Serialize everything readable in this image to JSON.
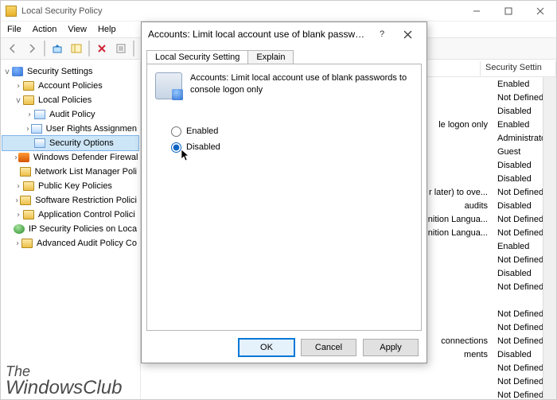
{
  "window": {
    "title": "Local Security Policy",
    "menus": [
      "File",
      "Action",
      "View",
      "Help"
    ]
  },
  "tree": {
    "root": "Security Settings",
    "items": [
      {
        "label": "Account Policies",
        "icon": "folder",
        "depth": 1,
        "twisty": ">"
      },
      {
        "label": "Local Policies",
        "icon": "folder",
        "depth": 1,
        "twisty": "v"
      },
      {
        "label": "Audit Policy",
        "icon": "book",
        "depth": 2,
        "twisty": ">"
      },
      {
        "label": "User Rights Assignmen",
        "icon": "book",
        "depth": 2,
        "twisty": ">"
      },
      {
        "label": "Security Options",
        "icon": "book",
        "depth": 2,
        "twisty": "",
        "selected": true
      },
      {
        "label": "Windows Defender Firewal",
        "icon": "fire",
        "depth": 1,
        "twisty": ">"
      },
      {
        "label": "Network List Manager Poli",
        "icon": "folder",
        "depth": 1,
        "twisty": ""
      },
      {
        "label": "Public Key Policies",
        "icon": "folder",
        "depth": 1,
        "twisty": ">"
      },
      {
        "label": "Software Restriction Polici",
        "icon": "folder",
        "depth": 1,
        "twisty": ">"
      },
      {
        "label": "Application Control Polici",
        "icon": "folder",
        "depth": 1,
        "twisty": ">"
      },
      {
        "label": "IP Security Policies on Loca",
        "icon": "globe",
        "depth": 1,
        "twisty": ""
      },
      {
        "label": "Advanced Audit Policy Co",
        "icon": "folder",
        "depth": 1,
        "twisty": ">"
      }
    ]
  },
  "list": {
    "header_setting": "Security Settin",
    "rows": [
      {
        "policy": "",
        "setting": "Enabled"
      },
      {
        "policy": "",
        "setting": "Not Defined"
      },
      {
        "policy": "",
        "setting": "Disabled"
      },
      {
        "policy": "le logon only",
        "setting": "Enabled"
      },
      {
        "policy": "",
        "setting": "Administrato"
      },
      {
        "policy": "",
        "setting": "Guest"
      },
      {
        "policy": "",
        "setting": "Disabled"
      },
      {
        "policy": "",
        "setting": "Disabled"
      },
      {
        "policy": "r later) to ove...",
        "setting": "Not Defined"
      },
      {
        "policy": "audits",
        "setting": "Disabled"
      },
      {
        "policy": "nition Langua...",
        "setting": "Not Defined"
      },
      {
        "policy": "nition Langua...",
        "setting": "Not Defined"
      },
      {
        "policy": "",
        "setting": "Enabled"
      },
      {
        "policy": "",
        "setting": "Not Defined"
      },
      {
        "policy": "",
        "setting": "Disabled"
      },
      {
        "policy": "",
        "setting": "Not Defined"
      },
      {
        "policy": "",
        "setting": ""
      },
      {
        "policy": "",
        "setting": "Not Defined"
      },
      {
        "policy": "",
        "setting": "Not Defined"
      },
      {
        "policy": "connections",
        "setting": "Not Defined"
      },
      {
        "policy": "ments",
        "setting": "Disabled"
      },
      {
        "policy": "",
        "setting": "Not Defined"
      },
      {
        "policy": "",
        "setting": "Not Defined"
      },
      {
        "policy": "",
        "setting": "Not Defined"
      }
    ]
  },
  "dialog": {
    "title": "Accounts: Limit local account use of blank passwords to c...",
    "tabs": {
      "active": "Local Security Setting",
      "inactive": "Explain"
    },
    "description": "Accounts: Limit local account use of blank passwords to console logon only",
    "radio_enabled": "Enabled",
    "radio_disabled": "Disabled",
    "buttons": {
      "ok": "OK",
      "cancel": "Cancel",
      "apply": "Apply"
    }
  },
  "watermark": {
    "line1": "The",
    "line2": "WindowsClub"
  }
}
